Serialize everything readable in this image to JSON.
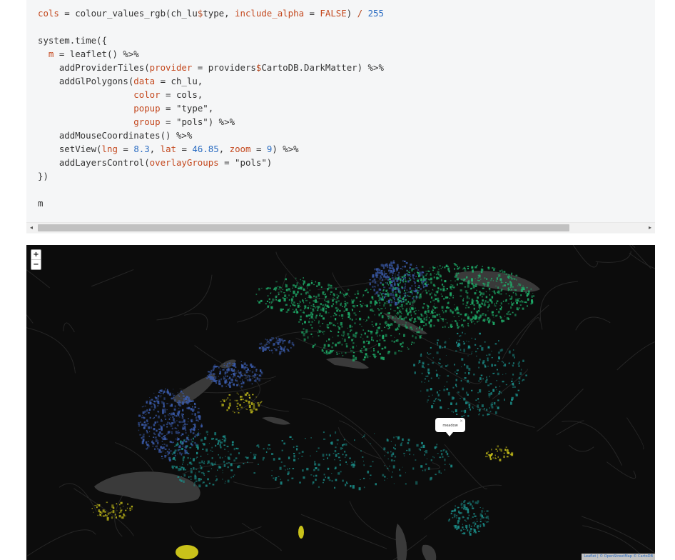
{
  "code": {
    "lines": [
      [
        {
          "t": "cols",
          "c": "arg"
        },
        {
          "t": " = colour_values_rgb(ch_lu",
          "c": "txt"
        },
        {
          "t": "$",
          "c": "op"
        },
        {
          "t": "type, ",
          "c": "txt"
        },
        {
          "t": "include_alpha",
          "c": "arg"
        },
        {
          "t": " = ",
          "c": "txt"
        },
        {
          "t": "FALSE",
          "c": "arg"
        },
        {
          "t": ") ",
          "c": "txt"
        },
        {
          "t": "/ ",
          "c": "op"
        },
        {
          "t": "255",
          "c": "num"
        }
      ],
      [],
      [
        {
          "t": "system.time({",
          "c": "txt"
        }
      ],
      [
        {
          "t": "  ",
          "c": "txt"
        },
        {
          "t": "m",
          "c": "arg"
        },
        {
          "t": " = leaflet() %>%",
          "c": "txt"
        }
      ],
      [
        {
          "t": "    addProviderTiles(",
          "c": "txt"
        },
        {
          "t": "provider",
          "c": "arg"
        },
        {
          "t": " = providers",
          "c": "txt"
        },
        {
          "t": "$",
          "c": "op"
        },
        {
          "t": "CartoDB.DarkMatter) %>%",
          "c": "txt"
        }
      ],
      [
        {
          "t": "    addGlPolygons(",
          "c": "txt"
        },
        {
          "t": "data",
          "c": "arg"
        },
        {
          "t": " = ch_lu,",
          "c": "txt"
        }
      ],
      [
        {
          "t": "                  ",
          "c": "txt"
        },
        {
          "t": "color",
          "c": "arg"
        },
        {
          "t": " = cols,",
          "c": "txt"
        }
      ],
      [
        {
          "t": "                  ",
          "c": "txt"
        },
        {
          "t": "popup",
          "c": "arg"
        },
        {
          "t": " = ",
          "c": "txt"
        },
        {
          "t": "\"type\"",
          "c": "str"
        },
        {
          "t": ",",
          "c": "txt"
        }
      ],
      [
        {
          "t": "                  ",
          "c": "txt"
        },
        {
          "t": "group",
          "c": "arg"
        },
        {
          "t": " = ",
          "c": "txt"
        },
        {
          "t": "\"pols\"",
          "c": "str"
        },
        {
          "t": ") %>%",
          "c": "txt"
        }
      ],
      [
        {
          "t": "    addMouseCoordinates() %>%",
          "c": "txt"
        }
      ],
      [
        {
          "t": "    setView(",
          "c": "txt"
        },
        {
          "t": "lng",
          "c": "arg"
        },
        {
          "t": " = ",
          "c": "txt"
        },
        {
          "t": "8.3",
          "c": "num"
        },
        {
          "t": ", ",
          "c": "txt"
        },
        {
          "t": "lat",
          "c": "arg"
        },
        {
          "t": " = ",
          "c": "txt"
        },
        {
          "t": "46.85",
          "c": "num"
        },
        {
          "t": ", ",
          "c": "txt"
        },
        {
          "t": "zoom",
          "c": "arg"
        },
        {
          "t": " = ",
          "c": "txt"
        },
        {
          "t": "9",
          "c": "num"
        },
        {
          "t": ") %>%",
          "c": "txt"
        }
      ],
      [
        {
          "t": "    addLayersControl(",
          "c": "txt"
        },
        {
          "t": "overlayGroups",
          "c": "arg"
        },
        {
          "t": " = ",
          "c": "txt"
        },
        {
          "t": "\"pols\"",
          "c": "str"
        },
        {
          "t": ")",
          "c": "txt"
        }
      ],
      [
        {
          "t": "})",
          "c": "txt"
        }
      ],
      [],
      [
        {
          "t": "m",
          "c": "txt"
        }
      ]
    ]
  },
  "scrollbar": {
    "left_arrow": "◂",
    "right_arrow": "▸"
  },
  "map": {
    "zoom_in": "+",
    "zoom_out": "−",
    "popup_text": "meadow",
    "popup_close": "×",
    "attribution": "Leaflet | © OpenStreetMap © CartoDB",
    "colors": {
      "background": "#0c0c0c",
      "lake": "#3a3a3a",
      "road": "#262626",
      "blue": "#3a5aa8",
      "green": "#1fae6a",
      "teal": "#1b8f8a",
      "yellow": "#c9c21a"
    }
  }
}
